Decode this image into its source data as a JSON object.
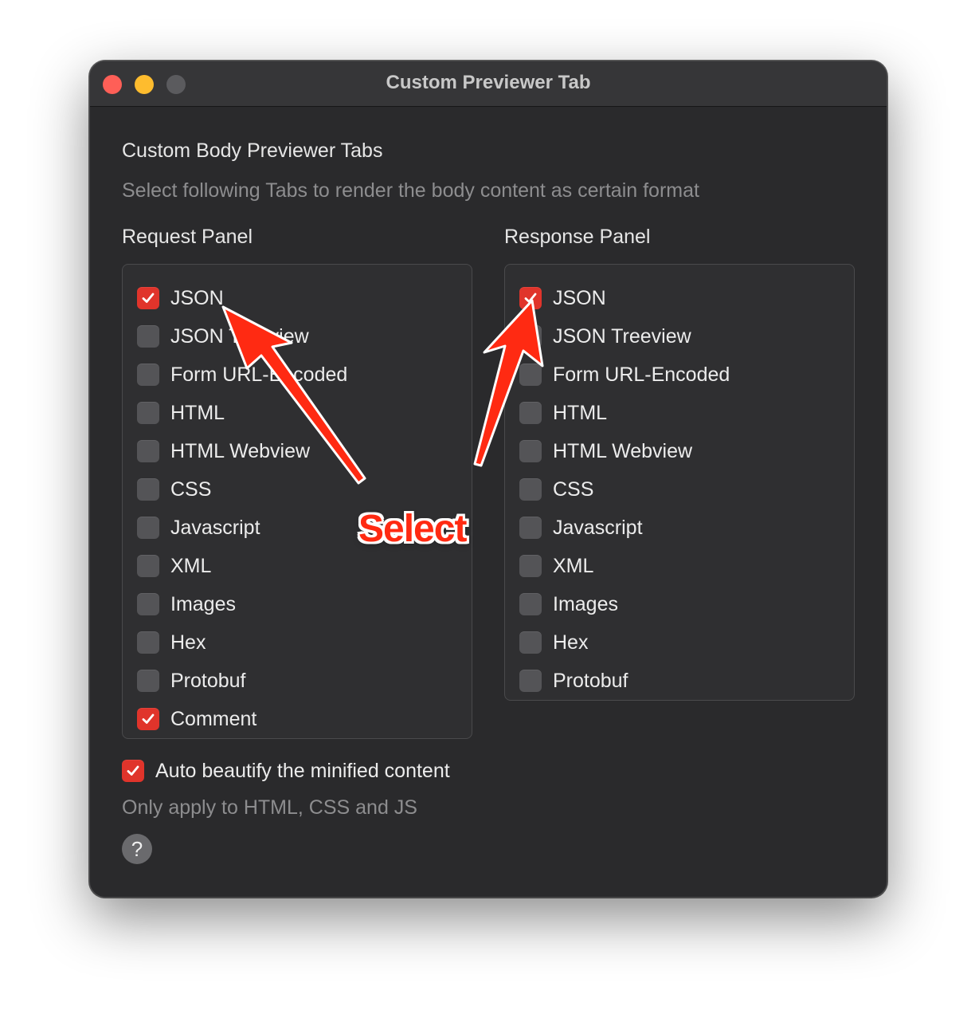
{
  "window": {
    "title": "Custom Previewer Tab"
  },
  "section": {
    "heading": "Custom Body Previewer Tabs",
    "description": "Select following Tabs to render the body content as certain format"
  },
  "request_panel": {
    "label": "Request Panel",
    "options": [
      {
        "label": "JSON",
        "checked": true
      },
      {
        "label": "JSON Treeview",
        "checked": false
      },
      {
        "label": "Form URL-Encoded",
        "checked": false
      },
      {
        "label": "HTML",
        "checked": false
      },
      {
        "label": "HTML Webview",
        "checked": false
      },
      {
        "label": "CSS",
        "checked": false
      },
      {
        "label": "Javascript",
        "checked": false
      },
      {
        "label": "XML",
        "checked": false
      },
      {
        "label": "Images",
        "checked": false
      },
      {
        "label": "Hex",
        "checked": false
      },
      {
        "label": "Protobuf",
        "checked": false
      },
      {
        "label": "Comment",
        "checked": true
      }
    ]
  },
  "response_panel": {
    "label": "Response Panel",
    "options": [
      {
        "label": "JSON",
        "checked": true
      },
      {
        "label": "JSON Treeview",
        "checked": false
      },
      {
        "label": "Form URL-Encoded",
        "checked": false
      },
      {
        "label": "HTML",
        "checked": false
      },
      {
        "label": "HTML Webview",
        "checked": false
      },
      {
        "label": "CSS",
        "checked": false
      },
      {
        "label": "Javascript",
        "checked": false
      },
      {
        "label": "XML",
        "checked": false
      },
      {
        "label": "Images",
        "checked": false
      },
      {
        "label": "Hex",
        "checked": false
      },
      {
        "label": "Protobuf",
        "checked": false
      }
    ]
  },
  "beautify": {
    "label": "Auto beautify the minified content",
    "checked": true,
    "note": "Only apply to HTML, CSS and JS"
  },
  "help": {
    "glyph": "?"
  },
  "annotation": {
    "text": "Select",
    "color": "#ff2a12"
  },
  "colors": {
    "checkbox_checked": "#e0342b",
    "window_bg": "#2a2a2c",
    "traffic_close": "#fe5f57",
    "traffic_minimize": "#febc2e"
  }
}
